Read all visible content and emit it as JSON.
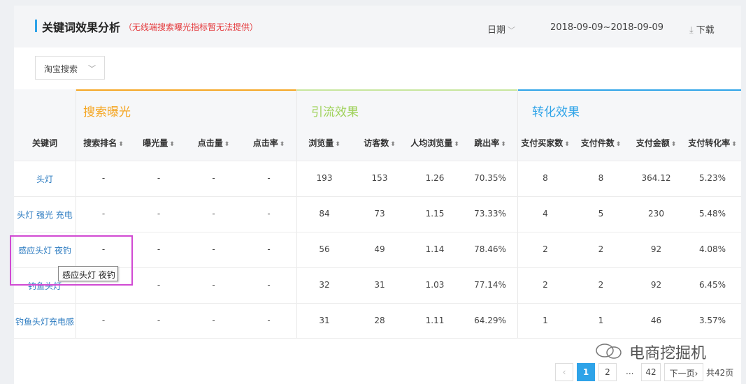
{
  "header": {
    "title": "关键词效果分析",
    "subtitle": "（无线端搜索曝光指标暂无法提供）",
    "date_label": "日期",
    "date_range": "2018-09-09~2018-09-09",
    "download_label": "下载"
  },
  "source_select": {
    "value": "淘宝搜索"
  },
  "groups": [
    {
      "title": "搜索曝光",
      "color": "#f5a623"
    },
    {
      "title": "引流效果",
      "color": "#9fd25a"
    },
    {
      "title": "转化效果",
      "color": "#2ea3e8"
    }
  ],
  "columns": [
    "关键词",
    "搜索排名",
    "曝光量",
    "点击量",
    "点击率",
    "浏览量",
    "访客数",
    "人均浏览量",
    "跳出率",
    "支付买家数",
    "支付件数",
    "支付金额",
    "支付转化率"
  ],
  "rows": [
    [
      "头灯",
      "-",
      "-",
      "-",
      "-",
      "193",
      "153",
      "1.26",
      "70.35%",
      "8",
      "8",
      "364.12",
      "5.23%"
    ],
    [
      "头灯 强光 充电",
      "-",
      "-",
      "-",
      "-",
      "84",
      "73",
      "1.15",
      "73.33%",
      "4",
      "5",
      "230",
      "5.48%"
    ],
    [
      "感应头灯 夜钓",
      "-",
      "-",
      "-",
      "-",
      "56",
      "49",
      "1.14",
      "78.46%",
      "2",
      "2",
      "92",
      "4.08%"
    ],
    [
      "钓鱼头灯",
      "-",
      "-",
      "-",
      "-",
      "32",
      "31",
      "1.03",
      "77.14%",
      "2",
      "2",
      "92",
      "6.45%"
    ],
    [
      "钓鱼头灯充电感",
      "-",
      "-",
      "-",
      "-",
      "31",
      "28",
      "1.11",
      "64.29%",
      "1",
      "1",
      "46",
      "3.57%"
    ]
  ],
  "tooltip": "感应头灯 夜钓",
  "pagination": {
    "prev_icon": "chevron-left-icon",
    "pages": [
      "1",
      "2"
    ],
    "current": "1",
    "ellipsis": "...",
    "last": "42",
    "next_label": "下一页",
    "total_label": "共42页"
  },
  "watermark": "电商挖掘机"
}
